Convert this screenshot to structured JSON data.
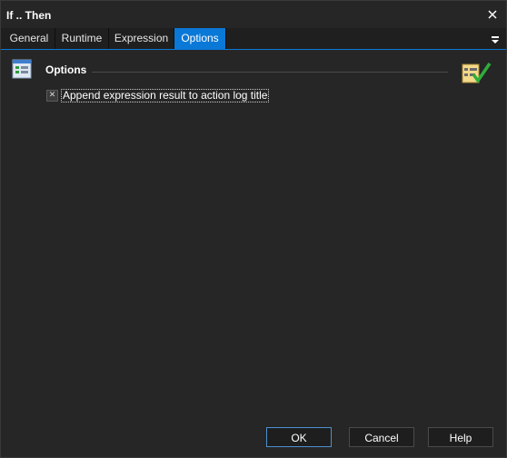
{
  "window": {
    "title": "If .. Then"
  },
  "tabs": [
    {
      "label": "General"
    },
    {
      "label": "Runtime"
    },
    {
      "label": "Expression"
    },
    {
      "label": "Options",
      "active": true
    }
  ],
  "section": {
    "title": "Options"
  },
  "options": {
    "append_expression": {
      "label": "Append expression result to action log title",
      "checked": true
    }
  },
  "buttons": {
    "ok": "OK",
    "cancel": "Cancel",
    "help": "Help"
  },
  "colors": {
    "accent": "#0a78d7",
    "background": "#262626",
    "text": "#ffffff"
  },
  "icons": {
    "close": "close-icon",
    "tab_menu": "tab-menu-icon",
    "section": "options-list-icon",
    "right": "checklist-icon"
  }
}
